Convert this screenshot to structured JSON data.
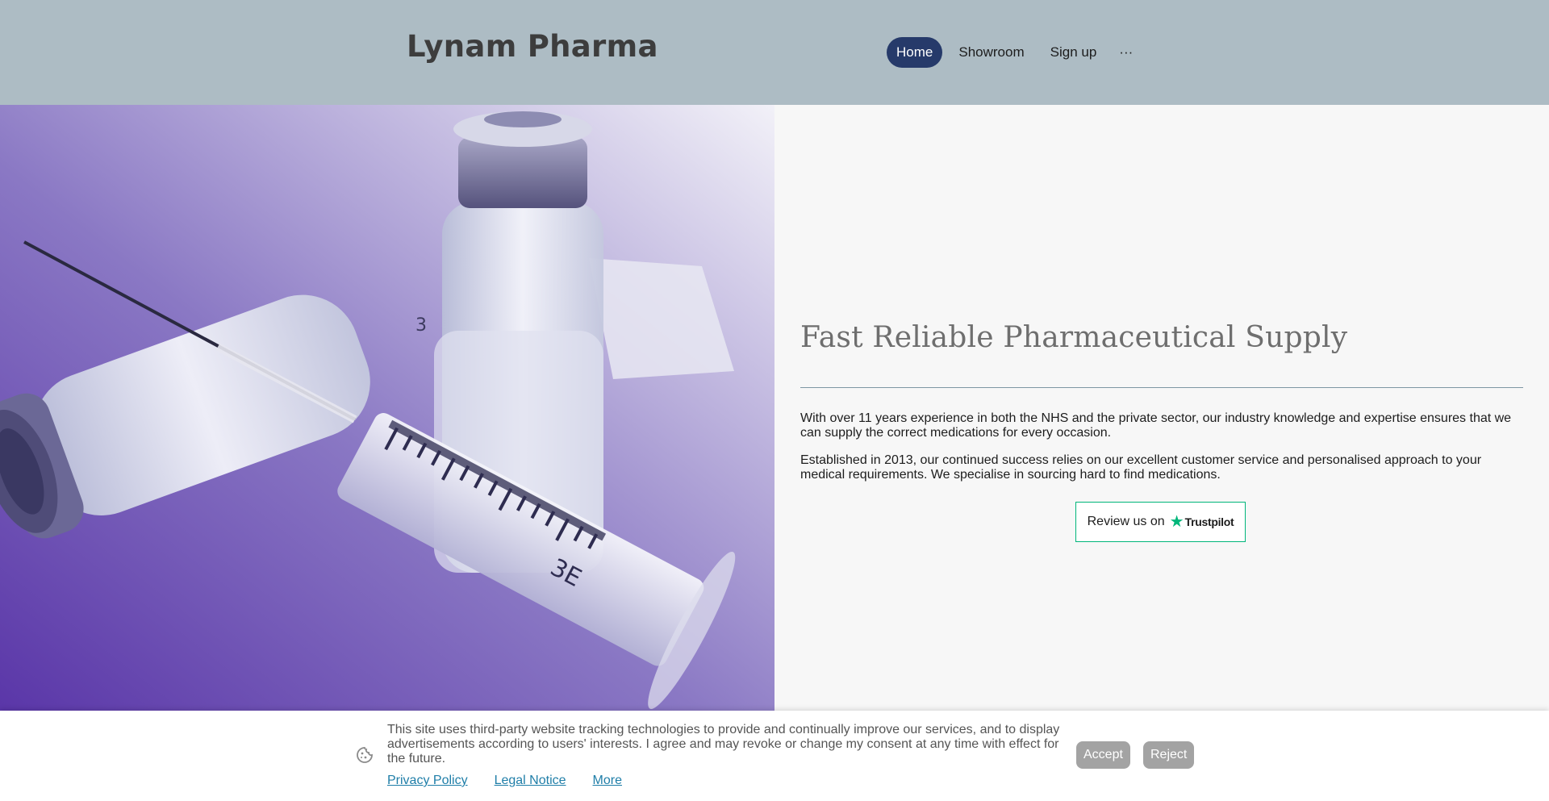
{
  "header": {
    "brand": "Lynam Pharma",
    "nav": [
      {
        "label": "Home",
        "active": true
      },
      {
        "label": "Showroom",
        "active": false
      },
      {
        "label": "Sign up",
        "active": false
      }
    ],
    "more_label": "···"
  },
  "hero": {
    "image_icon": "syringe-and-vial-photo",
    "vial_marking": "3",
    "syringe_marking": "3E"
  },
  "main": {
    "title": "Fast Reliable Pharmaceutical Supply",
    "paragraphs": [
      "With over 11 years experience in both the NHS and the private sector, our industry knowledge and expertise ensures that we can supply the correct medications for every occasion.",
      "Established in 2013, our continued success relies on our excellent customer service and personalised approach to your medical requirements. We specialise in sourcing hard to find medications."
    ],
    "review_button": {
      "label": "Review us on",
      "brand": "Trustpilot",
      "icon": "star-icon"
    }
  },
  "cookie": {
    "icon": "cookie-icon",
    "text": "This site uses third-party website tracking technologies to provide and continually improve our services, and to display advertisements according to users' interests. I agree and may revoke or change my consent at any time with effect for the future.",
    "links": [
      "Privacy Policy",
      "Legal Notice",
      "More"
    ],
    "accept_label": "Accept",
    "reject_label": "Reject"
  },
  "colors": {
    "header_bg": "#adbcc4",
    "nav_active": "#263a6a",
    "trustpilot_green": "#00b67a",
    "link": "#1f7ea8",
    "hero_purple": "#6a4fb0"
  }
}
